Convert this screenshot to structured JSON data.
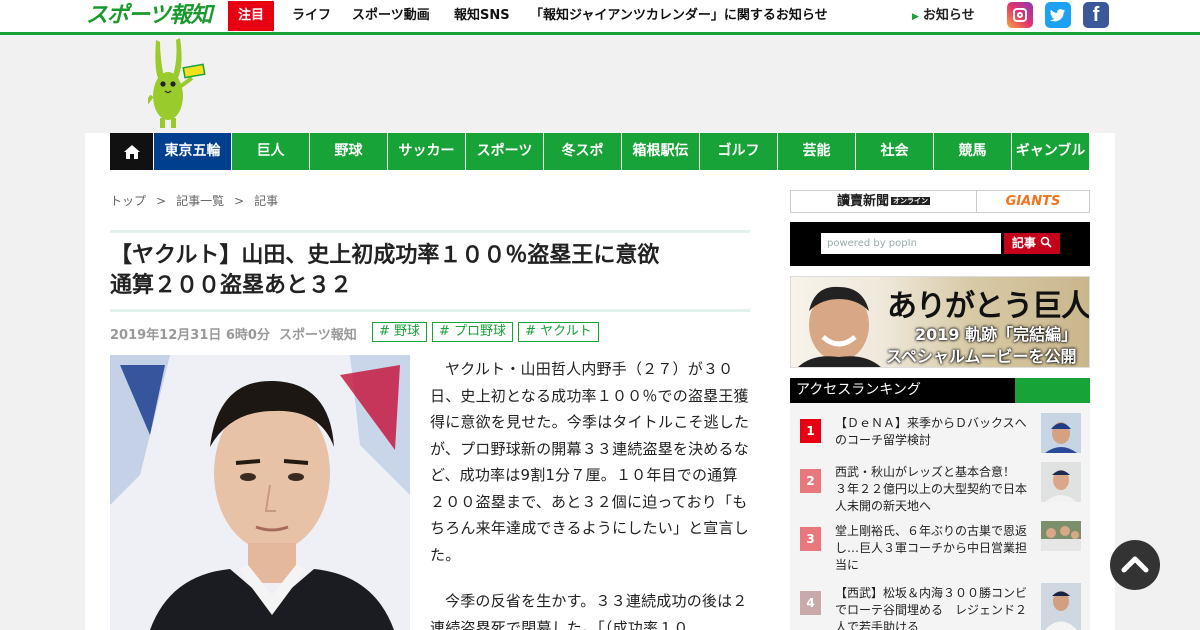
{
  "header": {
    "logo": "スポーツ報知",
    "chumoku": "注目",
    "links": [
      {
        "label": "ライフ"
      },
      {
        "label": "スポーツ動画"
      },
      {
        "label": "報知SNS"
      },
      {
        "label": "「報知ジャイアンツカレンダー」に関するお知らせ"
      }
    ],
    "notice": "お知らせ",
    "social": {
      "instagram": "instagram-icon",
      "twitter": "twitter-icon",
      "facebook": "facebook-icon"
    }
  },
  "nav": {
    "home": "home-icon",
    "items": [
      "東京五輪",
      "巨人",
      "野球",
      "サッカー",
      "スポーツ",
      "冬スポ",
      "箱根駅伝",
      "ゴルフ",
      "芸能",
      "社会",
      "競馬",
      "ギャンブル"
    ]
  },
  "breadcrumb": [
    "トップ",
    "記事一覧",
    "記事"
  ],
  "breadcrumb_sep": ">",
  "article": {
    "headline_line1": "【ヤクルト】山田、史上初成功率１００％盗塁王に意欲",
    "headline_line2": "通算２００盗塁あと３２",
    "date": "2019年12月31日 6時0分",
    "source": "スポーツ報知",
    "tags": [
      "# 野球",
      "# プロ野球",
      "# ヤクルト"
    ],
    "para1": "ヤクルト・山田哲人内野手（２７）が３０日、史上初となる成功率１００％での盗塁王獲得に意欲を見せた。今季はタイトルこそ逃したが、プロ野球新の開幕３３連続盗塁を決めるなど、成功率は9割1分７厘。１０年目での通算２００盗塁まで、あと３２個に迫っており「もちろん来年達成できるようにしたい」と宣言した。",
    "para2": "今季の反省を生かす。３３連続成功の後は２連続盗塁死で閉幕した。「（成功率１０"
  },
  "sidebar": {
    "yomiuri": "讀賣新聞",
    "yomiuri_online": "オンライン",
    "giants": "GIANTS",
    "search_placeholder": "powered by popIn",
    "search_button": "記事",
    "banner_line1": "ありがとう巨人",
    "banner_line2": "2019 軌跡「完結編」",
    "banner_line3": "スペシャルムービーを公開",
    "ranking_title": "アクセスランキング",
    "ranking": [
      {
        "num": "1",
        "title": "【ＤｅＮＡ】来季からＤバックスへのコーチ留学検討",
        "color": "#e60012"
      },
      {
        "num": "2",
        "title": "西武・秋山がレッズと基本合意！　３年２２億円以上の大型契約で日本人未開の新天地へ",
        "color": "#e8787e"
      },
      {
        "num": "3",
        "title": "堂上剛裕氏、６年ぶりの古巣で恩返し…巨人３軍コーチから中日営業担当に",
        "color": "#e8787e"
      },
      {
        "num": "4",
        "title": "【西武】松坂＆内海３００勝コンビでローテ谷間埋める　レジェンド２人で若手助ける",
        "color": "#c9a9aa"
      }
    ]
  },
  "colors": {
    "brand_green": "#18a338",
    "olympic_blue": "#003f8e",
    "accent_red": "#e60012"
  }
}
